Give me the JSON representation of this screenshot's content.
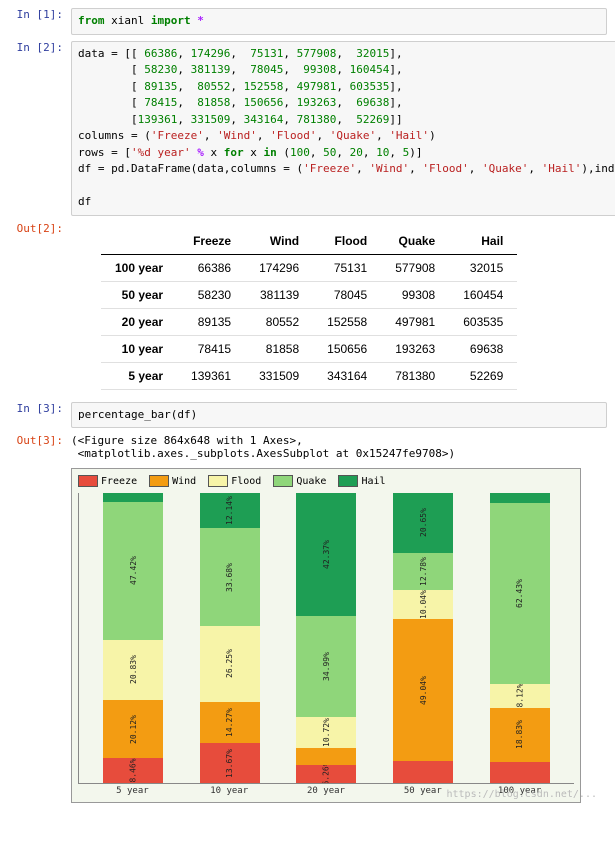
{
  "cells": {
    "in1": {
      "prompt": "In  [1]:",
      "code_html": "<span class='kw'>from</span> xianl <span class='kw'>import</span> <span class='op'>*</span>"
    },
    "in2": {
      "prompt": "In  [2]:",
      "code_html": "data = [[ <span class='num'>66386</span>, <span class='num'>174296</span>,  <span class='num'>75131</span>, <span class='num'>577908</span>,  <span class='num'>32015</span>],\n        [ <span class='num'>58230</span>, <span class='num'>381139</span>,  <span class='num'>78045</span>,  <span class='num'>99308</span>, <span class='num'>160454</span>],\n        [ <span class='num'>89135</span>,  <span class='num'>80552</span>, <span class='num'>152558</span>, <span class='num'>497981</span>, <span class='num'>603535</span>],\n        [ <span class='num'>78415</span>,  <span class='num'>81858</span>, <span class='num'>150656</span>, <span class='num'>193263</span>,  <span class='num'>69638</span>],\n        [<span class='num'>139361</span>, <span class='num'>331509</span>, <span class='num'>343164</span>, <span class='num'>781380</span>,  <span class='num'>52269</span>]]\ncolumns = (<span class='str'>'Freeze'</span>, <span class='str'>'Wind'</span>, <span class='str'>'Flood'</span>, <span class='str'>'Quake'</span>, <span class='str'>'Hail'</span>)\nrows = [<span class='str'>'%d year'</span> <span class='op'>%</span> x <span class='kw'>for</span> x <span class='kw'>in</span> (<span class='num'>100</span>, <span class='num'>50</span>, <span class='num'>20</span>, <span class='num'>10</span>, <span class='num'>5</span>)]\ndf = pd.DataFrame(data,columns = (<span class='str'>'Freeze'</span>, <span class='str'>'Wind'</span>, <span class='str'>'Flood'</span>, <span class='str'>'Quake'</span>, <span class='str'>'Hail'</span>),index = rows)\n\ndf"
    },
    "out2": {
      "prompt": "Out[2]:"
    },
    "in3": {
      "prompt": "In  [3]:",
      "code_html": "percentage_bar(df)"
    },
    "out3": {
      "prompt": "Out[3]:",
      "text": "(<Figure size 864x648 with 1 Axes>,\n <matplotlib.axes._subplots.AxesSubplot at 0x15247fe9708>)"
    }
  },
  "table": {
    "columns": [
      "Freeze",
      "Wind",
      "Flood",
      "Quake",
      "Hail"
    ],
    "index": [
      "100 year",
      "50 year",
      "20 year",
      "10 year",
      "5 year"
    ],
    "rows": [
      [
        "66386",
        "174296",
        "75131",
        "577908",
        "32015"
      ],
      [
        "58230",
        "381139",
        "78045",
        "99308",
        "160454"
      ],
      [
        "89135",
        "80552",
        "152558",
        "497981",
        "603535"
      ],
      [
        "78415",
        "81858",
        "150656",
        "193263",
        "69638"
      ],
      [
        "139361",
        "331509",
        "343164",
        "781380",
        "52269"
      ]
    ]
  },
  "chart_data": {
    "type": "bar",
    "stacked": true,
    "normalized_percent": true,
    "categories": [
      "5 year",
      "10 year",
      "20 year",
      "50 year",
      "100 year"
    ],
    "series": [
      {
        "name": "Freeze",
        "color": "#e74c3c",
        "values": [
          8.46,
          13.67,
          6.26,
          7.49,
          7.17
        ],
        "labels": [
          "8.46%",
          "13.67%",
          "6.26%",
          "",
          ""
        ]
      },
      {
        "name": "Wind",
        "color": "#f39c12",
        "values": [
          20.12,
          14.27,
          5.66,
          49.04,
          18.83
        ],
        "labels": [
          "20.12%",
          "14.27%",
          "",
          "49.04%",
          "18.83%"
        ]
      },
      {
        "name": "Flood",
        "color": "#f7f4a8",
        "values": [
          20.83,
          26.25,
          10.72,
          10.04,
          8.12
        ],
        "labels": [
          "20.83%",
          "26.25%",
          "10.72%",
          "10.04%",
          "8.12%"
        ]
      },
      {
        "name": "Quake",
        "color": "#8fd67a",
        "values": [
          47.42,
          33.68,
          34.99,
          12.78,
          62.43
        ],
        "labels": [
          "47.42%",
          "33.68%",
          "34.99%",
          "12.78%",
          "62.43%"
        ]
      },
      {
        "name": "Hail",
        "color": "#1e9e54",
        "values": [
          3.17,
          12.14,
          42.37,
          20.65,
          3.46
        ],
        "labels": [
          "3.17%",
          "12.14%",
          "42.37%",
          "20.65%",
          "3.46%"
        ]
      }
    ],
    "legend_position": "top",
    "ylim": [
      0,
      100
    ]
  },
  "watermark": "https://blog.csdn.net/..."
}
